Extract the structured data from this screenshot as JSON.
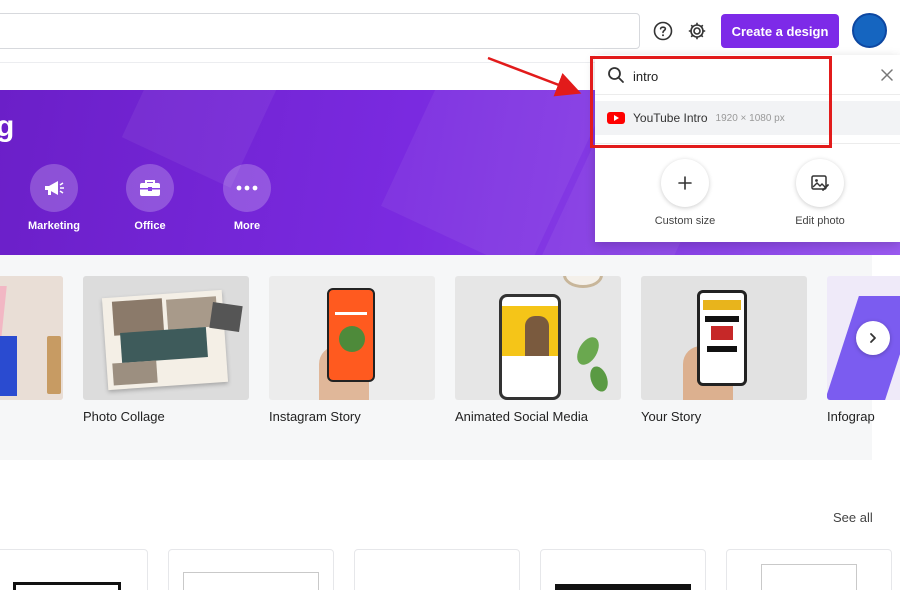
{
  "header": {
    "create_label": "Create a design",
    "help_icon": "question-circle-icon",
    "settings_icon": "gear-icon"
  },
  "hero": {
    "title": "g",
    "categories": [
      {
        "label": "Marketing",
        "icon": "megaphone-icon"
      },
      {
        "label": "Office",
        "icon": "briefcase-icon"
      },
      {
        "label": "More",
        "icon": "more-dots-icon"
      }
    ]
  },
  "templates": {
    "items": [
      {
        "label": ""
      },
      {
        "label": "Photo Collage"
      },
      {
        "label": "Instagram Story"
      },
      {
        "label": "Animated Social Media"
      },
      {
        "label": "Your Story"
      },
      {
        "label": "Infograp"
      }
    ],
    "next_icon": "chevron-right-icon"
  },
  "section": {
    "see_all": "See all"
  },
  "dropdown": {
    "query": "intro",
    "result_label": "YouTube Intro",
    "result_size": "1920 × 1080 px",
    "actions": [
      {
        "label": "Custom size",
        "icon": "plus-icon"
      },
      {
        "label": "Edit photo",
        "icon": "edit-photo-icon"
      }
    ]
  },
  "colors": {
    "accent": "#7d2ae8",
    "annotation": "#e21b1b"
  }
}
